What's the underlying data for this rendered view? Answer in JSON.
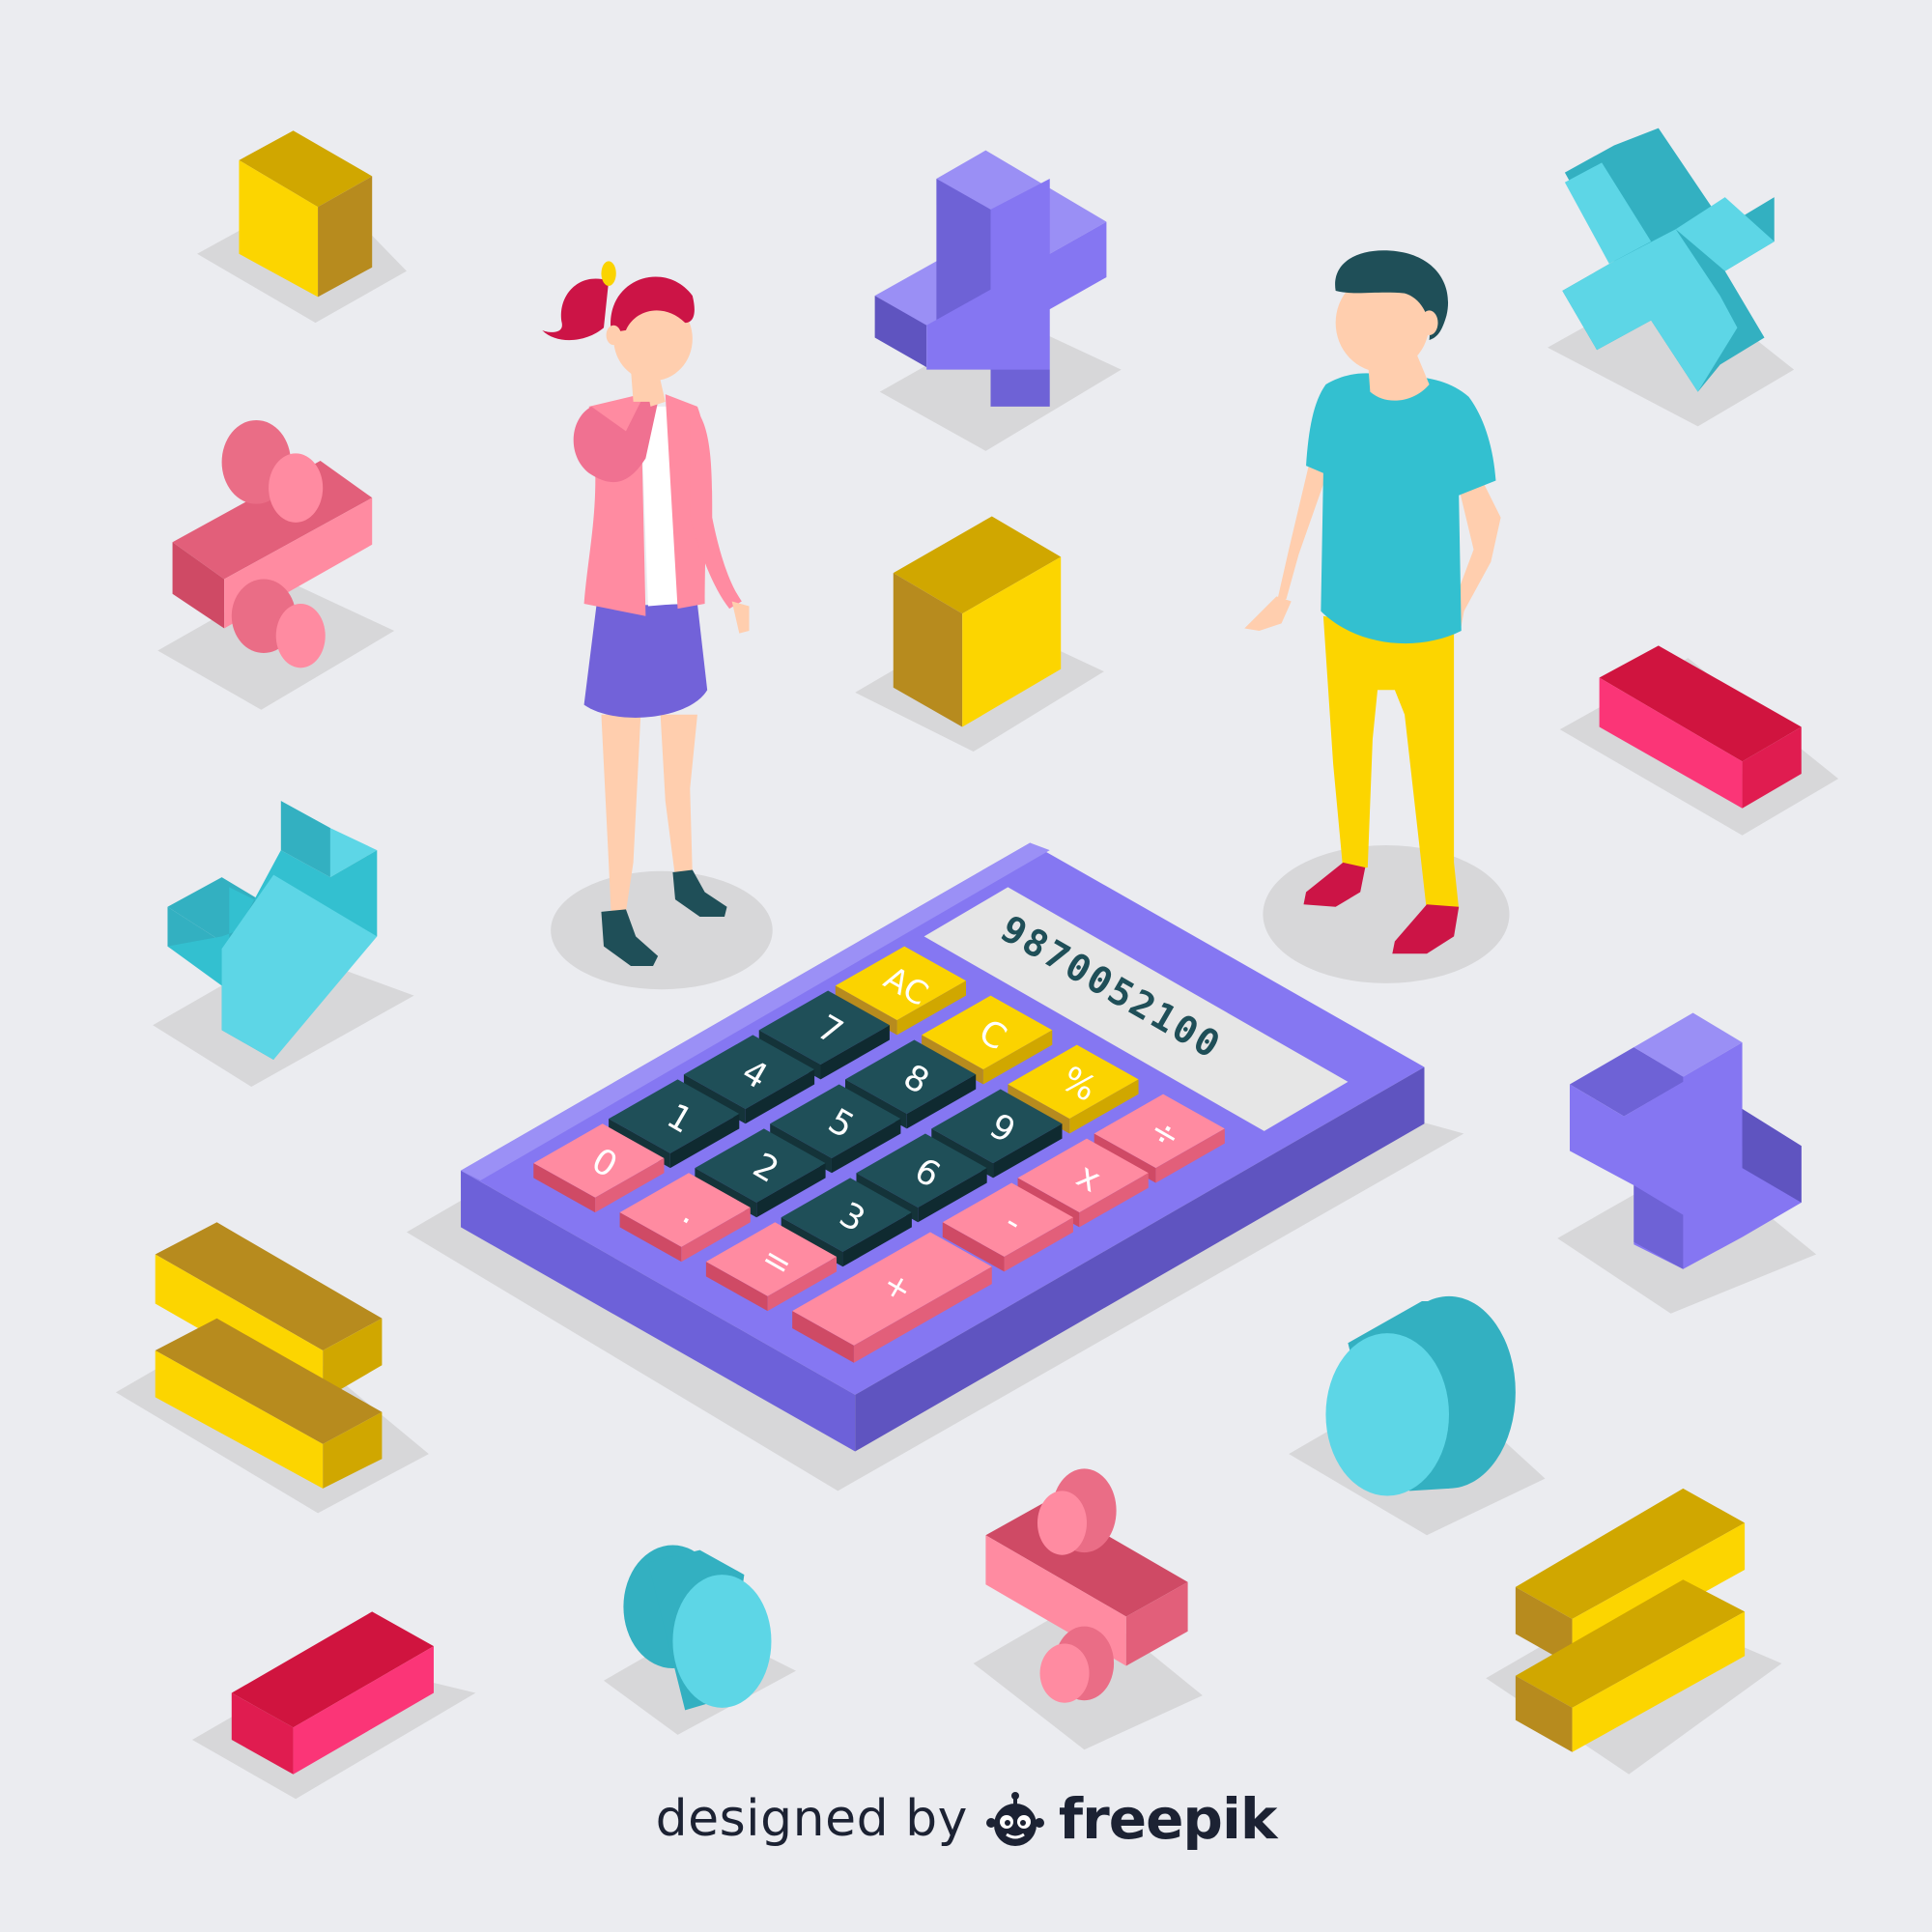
{
  "calculator": {
    "display": "9870052100",
    "keys": {
      "ac": "AC",
      "c": "C",
      "percent": "%",
      "divide": "÷",
      "seven": "7",
      "eight": "8",
      "nine": "9",
      "multiply": "x",
      "four": "4",
      "five": "5",
      "six": "6",
      "minus": "-",
      "one": "1",
      "two": "2",
      "three": "3",
      "zero": "0",
      "dot": ".",
      "equals": "=",
      "plus": "+"
    }
  },
  "credit": {
    "prefix": "designed by",
    "brand": "freepik",
    "logo_icon": "freepik-robot-logo-icon"
  },
  "colors": {
    "background": "#ebecf0",
    "calculator_body": "#7e72ec",
    "key_dark": "#1f4f58",
    "key_yellow": "#fbd300",
    "key_pink": "#ff8ba1",
    "display": "#e6e6e6",
    "display_text": "#1f4f58"
  }
}
